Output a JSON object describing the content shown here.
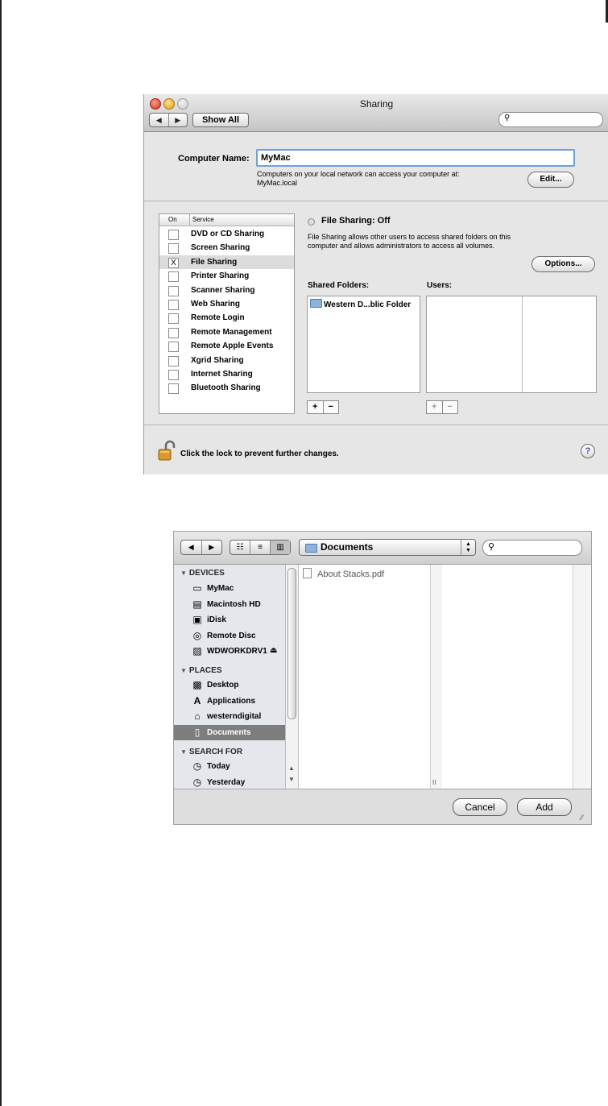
{
  "sharing": {
    "title": "Sharing",
    "show_all": "Show All",
    "back_glyph": "◀",
    "fwd_glyph": "▶",
    "search_placeholder": "",
    "computer_name_label": "Computer Name:",
    "computer_name_value": "MyMac",
    "access_note_1": "Computers on your local network can access your computer at:",
    "access_note_2": "MyMac.local",
    "edit_button": "Edit...",
    "service_header_on": "On",
    "service_header_service": "Service",
    "services": [
      {
        "label": "DVD or CD Sharing",
        "checked": ""
      },
      {
        "label": "Screen Sharing",
        "checked": ""
      },
      {
        "label": "File Sharing",
        "checked": "X"
      },
      {
        "label": "Printer Sharing",
        "checked": ""
      },
      {
        "label": "Scanner Sharing",
        "checked": ""
      },
      {
        "label": "Web Sharing",
        "checked": ""
      },
      {
        "label": "Remote Login",
        "checked": ""
      },
      {
        "label": "Remote Management",
        "checked": ""
      },
      {
        "label": "Remote Apple Events",
        "checked": ""
      },
      {
        "label": "Xgrid Sharing",
        "checked": ""
      },
      {
        "label": "Internet Sharing",
        "checked": ""
      },
      {
        "label": "Bluetooth Sharing",
        "checked": ""
      }
    ],
    "file_sharing_status": "File Sharing: Off",
    "file_sharing_desc": "File Sharing allows other users to access shared folders on this computer and allows administrators to access all volumes.",
    "options_button": "Options...",
    "shared_folders_label": "Shared Folders:",
    "users_label": "Users:",
    "shared_folder_item": "Western D...blic Folder",
    "plus": "+",
    "minus": "−",
    "lock_text": "Click the lock to prevent further changes.",
    "help": "?"
  },
  "open_panel": {
    "location": "Documents",
    "popup_arrows": "▲\n▼",
    "search_glyph": "🔍",
    "view_icons": [
      "☷",
      "≡",
      "▥"
    ],
    "devices_header": "DEVICES",
    "devices": [
      {
        "label": "MyMac",
        "icon": "laptop-icon",
        "glyph": "▭"
      },
      {
        "label": "Macintosh HD",
        "icon": "hard-drive-icon",
        "glyph": "▤"
      },
      {
        "label": "iDisk",
        "icon": "idisk-icon",
        "glyph": "▣"
      },
      {
        "label": "Remote Disc",
        "icon": "disc-icon",
        "glyph": "◎"
      },
      {
        "label": "WDWORKDRV1",
        "icon": "network-drive-icon",
        "glyph": "▨"
      }
    ],
    "eject": "⏏",
    "places_header": "PLACES",
    "places": [
      {
        "label": "Desktop",
        "icon": "desktop-icon",
        "glyph": "▩"
      },
      {
        "label": "Applications",
        "icon": "applications-icon",
        "glyph": "A"
      },
      {
        "label": "westerndigital",
        "icon": "home-icon",
        "glyph": "⌂"
      },
      {
        "label": "Documents",
        "icon": "documents-folder-icon",
        "glyph": "▯"
      }
    ],
    "search_header": "SEARCH FOR",
    "search_for": [
      {
        "label": "Today",
        "icon": "clock-icon",
        "glyph": "◷"
      },
      {
        "label": "Yesterday",
        "icon": "clock-icon",
        "glyph": "◷"
      }
    ],
    "file_item": "About Stacks.pdf",
    "col_grip": "II",
    "cancel_button": "Cancel",
    "add_button": "Add",
    "grow_glyph": "◢"
  }
}
